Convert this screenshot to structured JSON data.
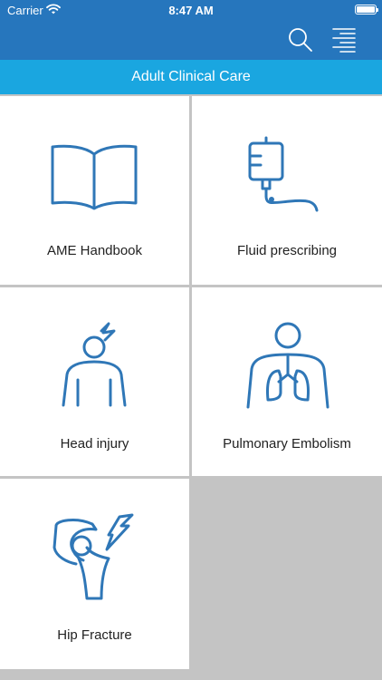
{
  "status_bar": {
    "carrier": "Carrier",
    "time": "8:47 AM",
    "icons": [
      "wifi-icon",
      "battery-icon"
    ]
  },
  "toolbar": {
    "icons": [
      "search-icon",
      "menu-icon"
    ],
    "color": "#2676bd"
  },
  "header": {
    "title": "Adult Clinical Care",
    "color": "#1aa6e0"
  },
  "tiles": [
    {
      "label": "AME Handbook",
      "icon": "book-icon"
    },
    {
      "label": "Fluid prescribing",
      "icon": "iv-drip-icon"
    },
    {
      "label": "Head injury",
      "icon": "head-injury-icon"
    },
    {
      "label": "Pulmonary Embolism",
      "icon": "lungs-icon"
    },
    {
      "label": "Hip Fracture",
      "icon": "hip-fracture-icon"
    }
  ],
  "colors": {
    "icon_stroke": "#2f77b7",
    "empty_area": "#c4c4c4"
  }
}
